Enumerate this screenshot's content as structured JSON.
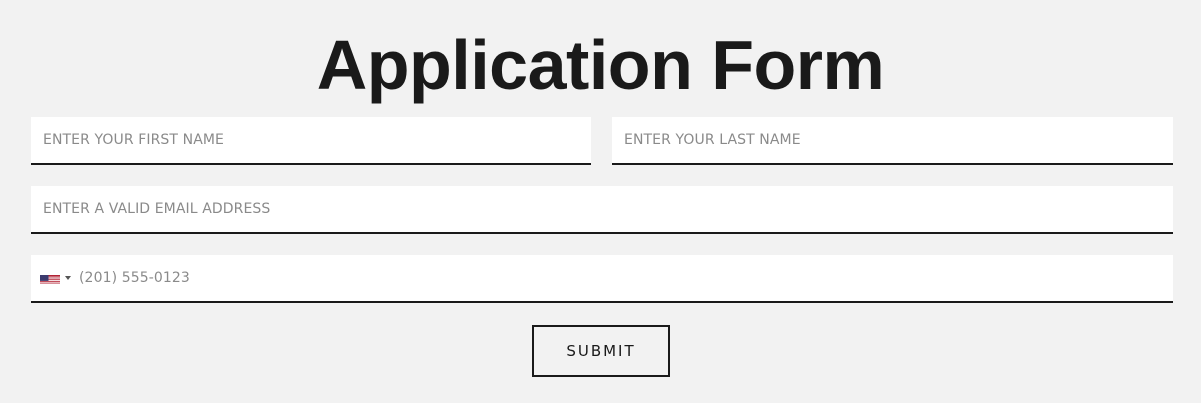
{
  "form": {
    "title": "Application Form",
    "first_name": {
      "placeholder": "ENTER YOUR FIRST NAME",
      "value": ""
    },
    "last_name": {
      "placeholder": "ENTER YOUR LAST NAME",
      "value": ""
    },
    "email": {
      "placeholder": "ENTER A VALID EMAIL ADDRESS",
      "value": ""
    },
    "phone": {
      "country_flag_icon": "us-flag-icon",
      "placeholder": "(201) 555-0123",
      "value": ""
    },
    "submit_label": "SUBMIT"
  },
  "colors": {
    "background": "#f2f2f2",
    "field_background": "#ffffff",
    "text_dark": "#1a1a1a",
    "placeholder": "#8a8a8a"
  }
}
